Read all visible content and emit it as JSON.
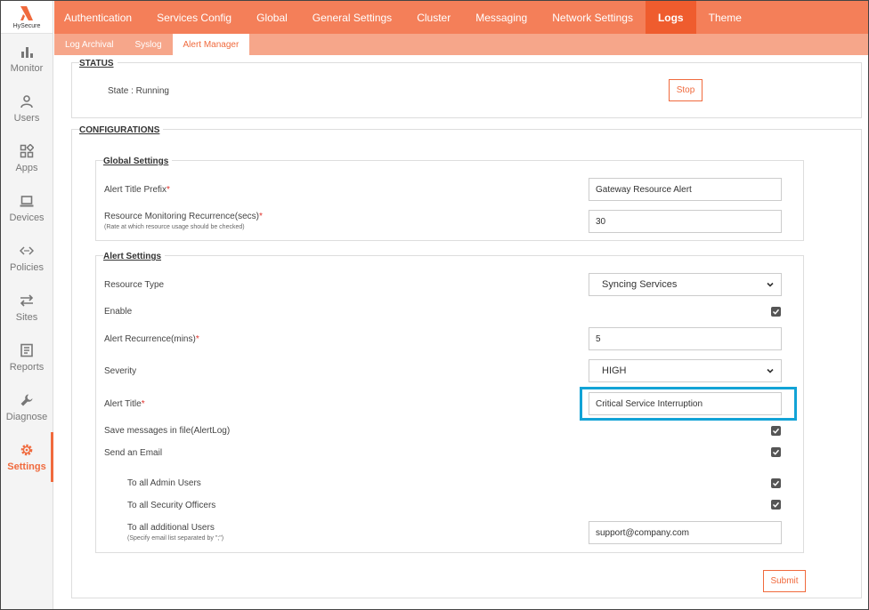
{
  "brand": {
    "logo_text": "HySecure",
    "accent": "#f06a3d"
  },
  "sidebar": {
    "items": [
      {
        "label": "Monitor",
        "icon": "bar-chart-icon"
      },
      {
        "label": "Users",
        "icon": "user-icon"
      },
      {
        "label": "Apps",
        "icon": "apps-icon"
      },
      {
        "label": "Devices",
        "icon": "laptop-icon"
      },
      {
        "label": "Policies",
        "icon": "code-icon"
      },
      {
        "label": "Sites",
        "icon": "swap-icon"
      },
      {
        "label": "Reports",
        "icon": "report-icon"
      },
      {
        "label": "Diagnose",
        "icon": "wrench-icon"
      },
      {
        "label": "Settings",
        "icon": "gear-icon",
        "active": true
      }
    ]
  },
  "topnav": {
    "tabs": [
      "Authentication",
      "Services Config",
      "Global",
      "General Settings",
      "Cluster",
      "Messaging",
      "Network Settings",
      "Logs",
      "Theme"
    ],
    "active": "Logs"
  },
  "subnav": {
    "tabs": [
      "Log Archival",
      "Syslog",
      "Alert Manager"
    ],
    "active": "Alert Manager"
  },
  "status": {
    "legend": "STATUS",
    "state_text": "State : Running",
    "stop_label": "Stop"
  },
  "configurations": {
    "legend": "CONFIGURATIONS",
    "global_settings": {
      "legend": "Global Settings",
      "alert_title_prefix_label": "Alert Title Prefix",
      "alert_title_prefix_value": "Gateway Resource Alert",
      "recurrence_label": "Resource Monitoring Recurrence(secs)",
      "recurrence_hint": "(Rate at which resource usage should be checked)",
      "recurrence_value": "30"
    },
    "alert_settings": {
      "legend": "Alert Settings",
      "resource_type_label": "Resource Type",
      "resource_type_value": "Syncing Services",
      "enable_label": "Enable",
      "alert_recurrence_label": "Alert Recurrence(mins)",
      "alert_recurrence_value": "5",
      "severity_label": "Severity",
      "severity_value": "HIGH",
      "alert_title_label": "Alert Title",
      "alert_title_value": "Critical Service Interruption",
      "save_messages_label": "Save messages in file(AlertLog)",
      "send_email_label": "Send an Email",
      "to_admins_label": "To all Admin Users",
      "to_security_label": "To all Security Officers",
      "to_additional_label": "To all additional Users",
      "to_additional_hint": "(Specify email list separated by \";\")",
      "to_additional_value": "support@company.com"
    },
    "submit_label": "Submit"
  },
  "required_marker": "*"
}
